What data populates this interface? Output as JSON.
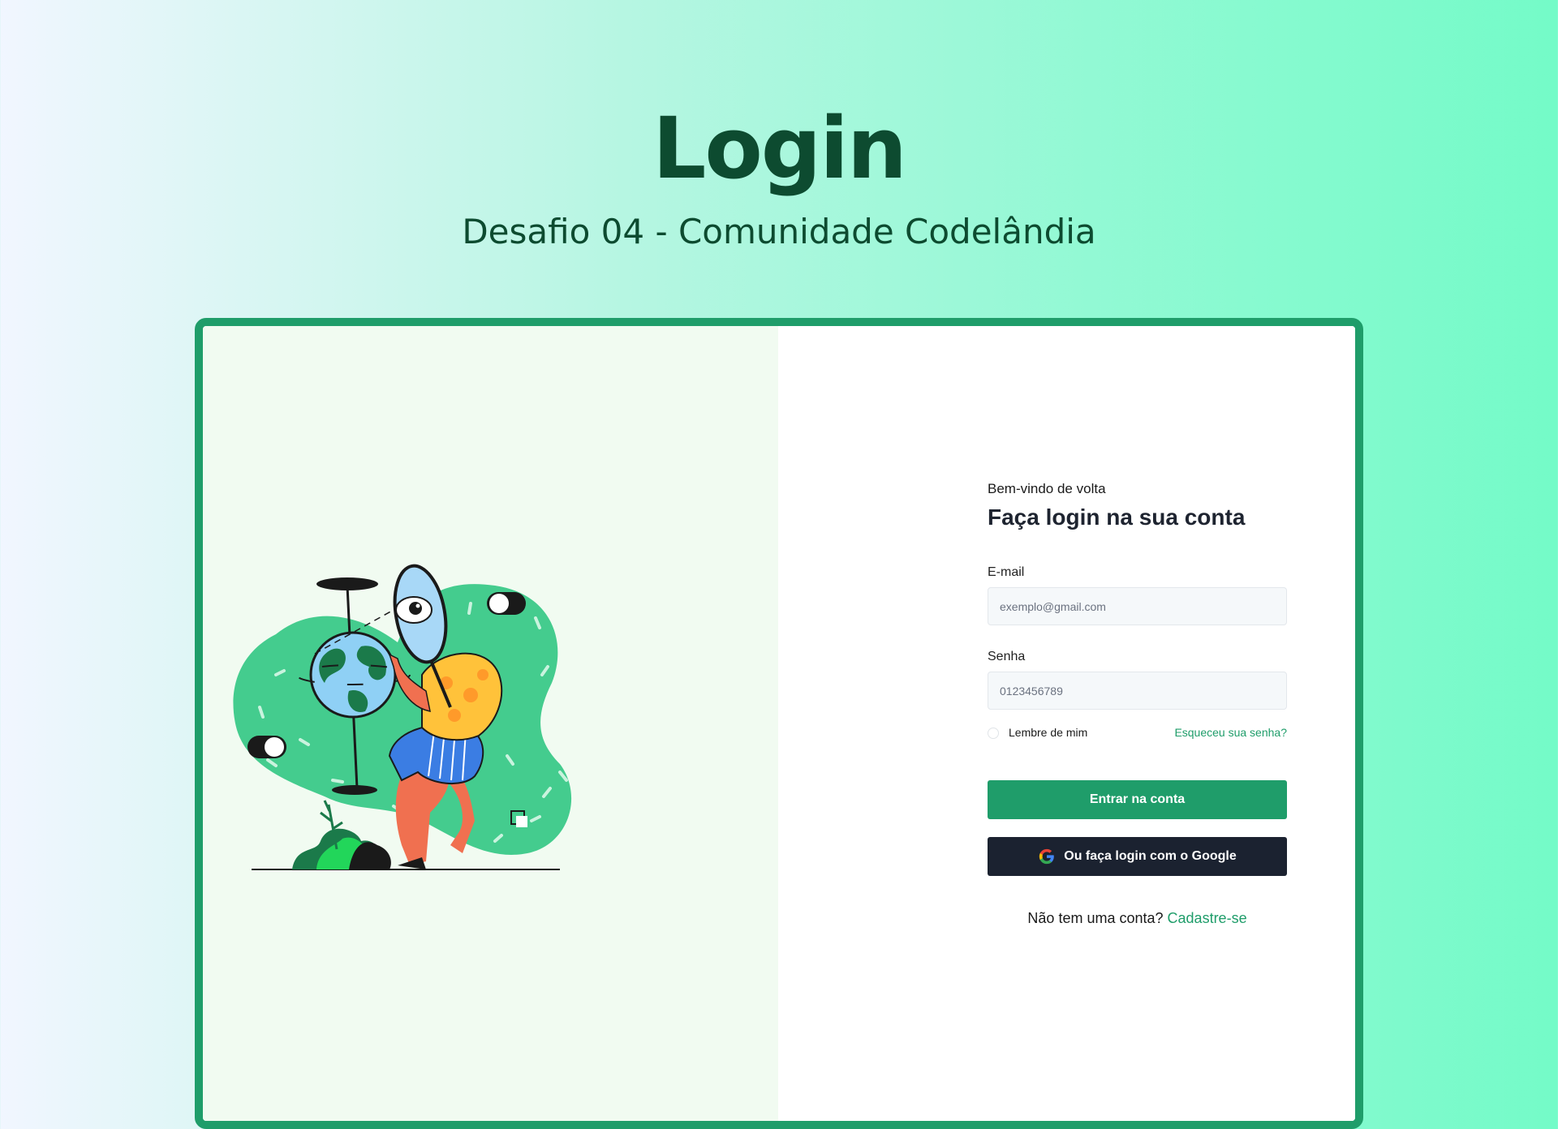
{
  "hero": {
    "title": "Login",
    "subtitle": "Desafio 04 - Comunidade Codelândia"
  },
  "illustration": {
    "icon": "person-with-magnifier-and-globe-illustration"
  },
  "form": {
    "welcome": "Bem-vindo de volta",
    "heading": "Faça login na sua conta",
    "email_label": "E-mail",
    "email_placeholder": "exemplo@gmail.com",
    "password_label": "Senha",
    "password_placeholder": "0123456789",
    "remember_label": "Lembre de mim",
    "forgot_label": "Esqueceu sua senha?",
    "submit_label": "Entrar na conta",
    "google_label": "Ou faça login com o Google",
    "google_icon": "google-icon",
    "signup_prompt": "Não tem uma conta?",
    "signup_link": "Cadastre-se"
  },
  "colors": {
    "accent": "#1f9d6a",
    "dark_button": "#1b2230",
    "title": "#0d4b30",
    "left_panel_bg": "#f1fbf1"
  }
}
